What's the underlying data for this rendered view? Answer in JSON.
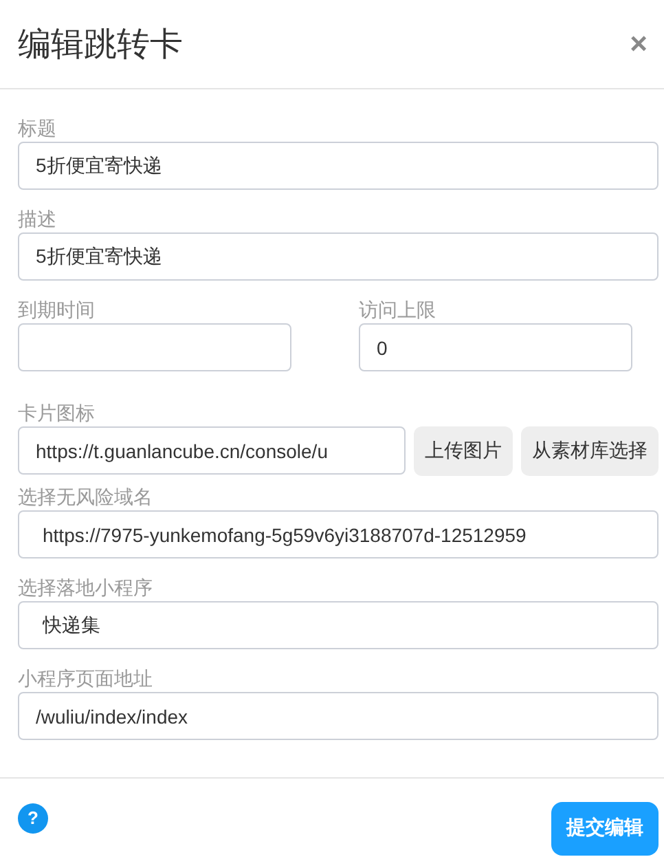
{
  "dialog": {
    "title": "编辑跳转卡",
    "close": "×"
  },
  "fields": [
    {
      "kind": "text",
      "label": "标题",
      "value": "5折便宜寄快递"
    },
    {
      "kind": "text",
      "label": "描述",
      "value": "5折便宜寄快递"
    },
    {
      "kind": "pair",
      "items": [
        {
          "label": "到期时间"
        },
        {
          "label": "访问上限",
          "value": "0"
        }
      ]
    },
    {
      "kind": "upload",
      "label": "卡片图标",
      "value": "https://t.guanlancube.cn/console/u",
      "buttons": [
        "上传图片",
        "从素材库选择"
      ]
    },
    {
      "kind": "select",
      "label": "选择无风险域名",
      "value": "https://7975-yunkemofang-5g59v6yi3188707d-12512959"
    },
    {
      "kind": "select",
      "label": "选择落地小程序",
      "value": "快递集"
    },
    {
      "kind": "text",
      "label": "小程序页面地址",
      "value": "/wuliu/index/index"
    }
  ],
  "footer": {
    "help": "?",
    "submit": "提交编辑"
  }
}
